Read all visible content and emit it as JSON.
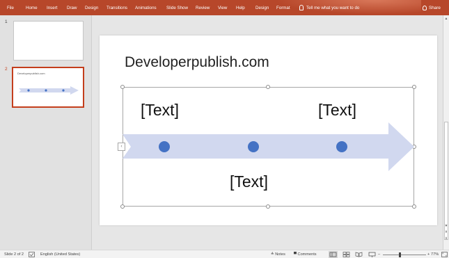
{
  "ribbon": {
    "tabs": [
      {
        "label": "File"
      },
      {
        "label": "Home"
      },
      {
        "label": "Insert"
      },
      {
        "label": "Draw"
      },
      {
        "label": "Design"
      },
      {
        "label": "Transitions"
      },
      {
        "label": "Animations"
      },
      {
        "label": "Slide Show"
      },
      {
        "label": "Review"
      },
      {
        "label": "View"
      },
      {
        "label": "Help"
      },
      {
        "label": "Design"
      },
      {
        "label": "Format"
      }
    ],
    "tell_me": "Tell me what you want to do",
    "share": "Share",
    "accent_color": "#b7472a"
  },
  "thumbnails": [
    {
      "number": "1",
      "title": ""
    },
    {
      "number": "2",
      "title": "Developerpublish.com",
      "selected": true
    }
  ],
  "slide": {
    "title": "Developerpublish.com",
    "timeline": {
      "nodes": [
        "[Text]",
        "[Text]",
        "[Text]"
      ],
      "arrow_color": "#d1d8ef",
      "dot_color": "#4472c4"
    }
  },
  "statusbar": {
    "slide_info": "Slide 2 of 2",
    "language": "English (United States)",
    "notes": "Notes",
    "comments": "Comments",
    "zoom": "77%",
    "zoom_minus": "–",
    "zoom_plus": "+"
  }
}
